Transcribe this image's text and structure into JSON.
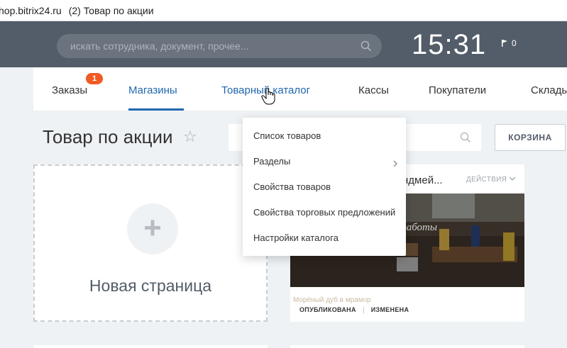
{
  "browser": {
    "url": "hop.bitrix24.ru",
    "tab_title": "(2) Товар по акции"
  },
  "topbar": {
    "search_placeholder": "искать сотрудника, документ, прочее...",
    "clock": "15:31",
    "notifications_count": "0"
  },
  "nav": {
    "items": [
      {
        "label": "Заказы",
        "badge": "1"
      },
      {
        "label": "Магазины",
        "state": "active"
      },
      {
        "label": "Товарный каталог",
        "state": "hover"
      },
      {
        "label": "Кассы"
      },
      {
        "label": "Покупатели"
      },
      {
        "label": "Склады"
      }
    ]
  },
  "page": {
    "title": "Товар по акции",
    "cart_button": "КОРЗИНА"
  },
  "new_page": {
    "label": "Новая страница"
  },
  "card": {
    "title": "ндмей...",
    "actions": "ДЕЙСТВИЯ",
    "caption": "Морёный дуб в мрамор",
    "status_published": "ОПУБЛИКОВАНА",
    "status_modified": "ИЗМЕНЕНА",
    "image_text": "ной работы"
  },
  "dropdown": {
    "items": [
      {
        "label": "Список товаров"
      },
      {
        "label": "Разделы",
        "has_submenu": true
      },
      {
        "label": "Свойства товаров"
      },
      {
        "label": "Свойства торговых предложений"
      },
      {
        "label": "Настройки каталога"
      }
    ]
  },
  "colors": {
    "topbar": "#535c69",
    "accent": "#2067b0",
    "badge": "#f15a24",
    "background": "#eef2f4"
  }
}
